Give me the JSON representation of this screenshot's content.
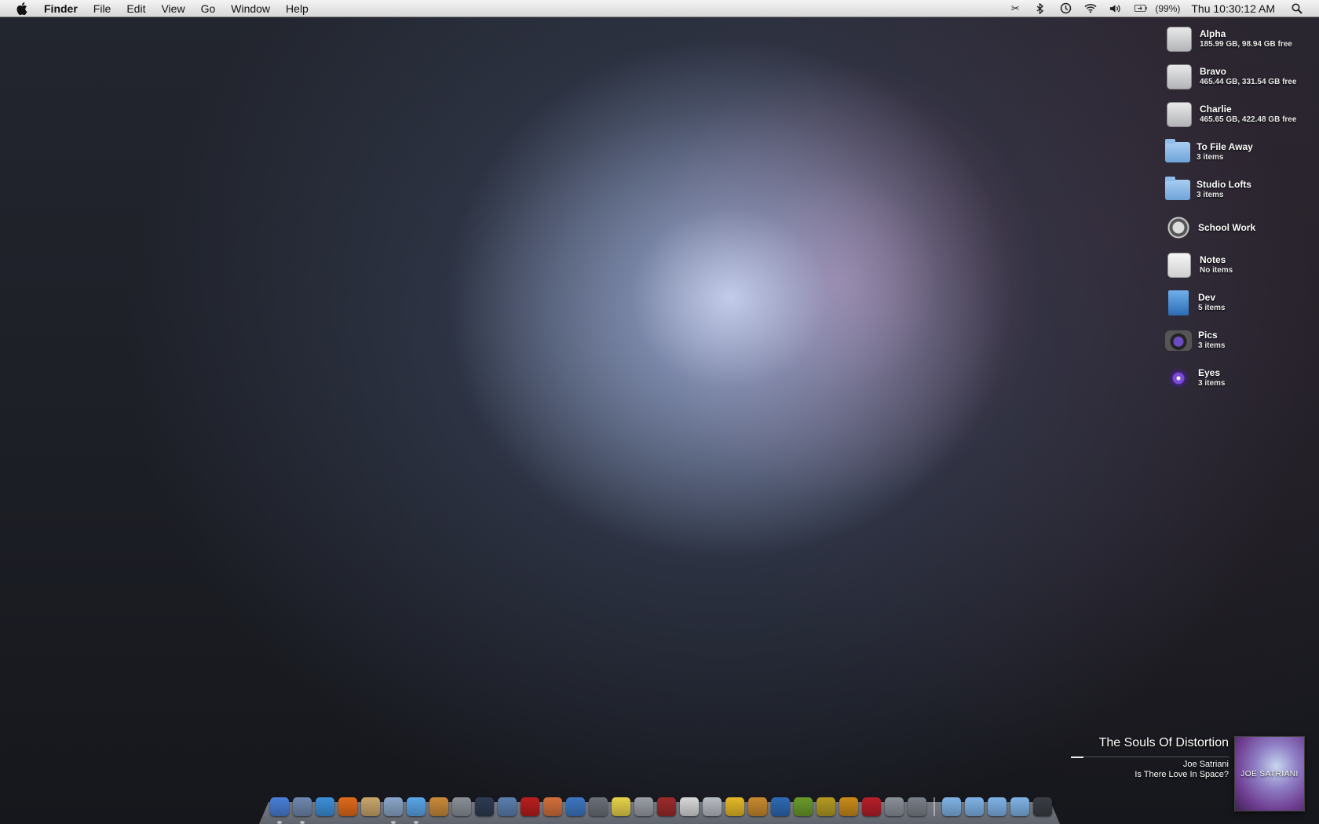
{
  "menubar": {
    "apple_icon": "apple-icon",
    "app_name": "Finder",
    "menus": [
      "File",
      "Edit",
      "View",
      "Go",
      "Window",
      "Help"
    ],
    "status_icons": [
      "scissors-icon",
      "bluetooth-icon",
      "time-machine-icon",
      "wifi-icon",
      "volume-icon",
      "battery-icon"
    ],
    "battery_percent": "(99%)",
    "clock": "Thu 10:30:12 AM",
    "spotlight_icon": "search-icon"
  },
  "desktop_icons": [
    {
      "name": "Alpha",
      "info": "185.99 GB, 98.94 GB free",
      "icon": "hard-drive-icon"
    },
    {
      "name": "Bravo",
      "info": "465.44 GB, 331.54 GB free",
      "icon": "time-machine-drive-icon"
    },
    {
      "name": "Charlie",
      "info": "465.65 GB, 422.48 GB free",
      "icon": "hard-drive-icon"
    },
    {
      "name": "To File Away",
      "info": "3 items",
      "icon": "folder-icon"
    },
    {
      "name": "Studio Lofts",
      "info": "3 items",
      "icon": "folder-icon"
    },
    {
      "name": "School Work",
      "info": "",
      "icon": "watch-alias-icon"
    },
    {
      "name": "Notes",
      "info": "No items",
      "icon": "notes-icon"
    },
    {
      "name": "Dev",
      "info": "5 items",
      "icon": "blueprint-icon"
    },
    {
      "name": "Pics",
      "info": "3 items",
      "icon": "camera-icon"
    },
    {
      "name": "Eyes",
      "info": "3 items",
      "icon": "eye-icon"
    }
  ],
  "now_playing": {
    "title": "The Souls Of Distortion",
    "artist": "Joe Satriani",
    "album": "Is There Love In Space?",
    "album_art_text": "JOE SATRIANI"
  },
  "dock": {
    "apps": [
      {
        "icon": "finder-icon",
        "color": "#4a7fd6",
        "running": true
      },
      {
        "icon": "mail-icon",
        "color": "#6f88b0",
        "running": true
      },
      {
        "icon": "safari-icon",
        "color": "#3d8fd8",
        "running": false
      },
      {
        "icon": "firefox-icon",
        "color": "#e06a1a",
        "running": false
      },
      {
        "icon": "address-book-icon",
        "color": "#c9a66b",
        "running": false
      },
      {
        "icon": "ichat-icon",
        "color": "#8aa6c8",
        "running": true
      },
      {
        "icon": "itunes-icon",
        "color": "#5aa6e8",
        "running": true
      },
      {
        "icon": "garageband-icon",
        "color": "#c98a3a",
        "running": false
      },
      {
        "icon": "iphoto-icon",
        "color": "#8a8f98",
        "running": false
      },
      {
        "icon": "telescope-icon",
        "color": "#2d3b52",
        "running": false
      },
      {
        "icon": "keychain-icon",
        "color": "#5b7fae",
        "running": false
      },
      {
        "icon": "photo-booth-icon",
        "color": "#b81f1f",
        "running": false
      },
      {
        "icon": "screen-sharing-icon",
        "color": "#d2703c",
        "running": false
      },
      {
        "icon": "activity-monitor-icon",
        "color": "#3e77c2",
        "running": false
      },
      {
        "icon": "script-editor-icon",
        "color": "#6a6f78",
        "running": false
      },
      {
        "icon": "stickies-icon",
        "color": "#e6d24a",
        "running": false
      },
      {
        "icon": "calculator-icon",
        "color": "#9a9ea6",
        "running": false
      },
      {
        "icon": "dictionary-icon",
        "color": "#9c2b2b",
        "running": false
      },
      {
        "icon": "textedit-icon",
        "color": "#d8d8d8",
        "running": false
      },
      {
        "icon": "preview-icon",
        "color": "#b8bcc4",
        "running": false
      },
      {
        "icon": "cyberduck-icon",
        "color": "#e5b928",
        "running": false
      },
      {
        "icon": "coda-icon",
        "color": "#c78a2e",
        "running": false
      },
      {
        "icon": "photoshop-icon",
        "color": "#2d6ab3",
        "running": false
      },
      {
        "icon": "dreamweaver-icon",
        "color": "#6a9a2a",
        "running": false
      },
      {
        "icon": "fireworks-icon",
        "color": "#b49a22",
        "running": false
      },
      {
        "icon": "illustrator-icon",
        "color": "#c98b1a",
        "running": false
      },
      {
        "icon": "flash-icon",
        "color": "#b51f2a",
        "running": false
      },
      {
        "icon": "migration-icon",
        "color": "#8a9099",
        "running": false
      },
      {
        "icon": "system-preferences-icon",
        "color": "#7a7f88",
        "running": false
      }
    ],
    "folders": [
      {
        "icon": "folder-icon",
        "color": "#7fb3e6"
      },
      {
        "icon": "folder-icon",
        "color": "#7fb3e6"
      },
      {
        "icon": "folder-icon",
        "color": "#7fb3e6"
      },
      {
        "icon": "downloads-folder-icon",
        "color": "#7fb3e6"
      },
      {
        "icon": "trash-icon",
        "color": "#3a3d44"
      }
    ]
  }
}
